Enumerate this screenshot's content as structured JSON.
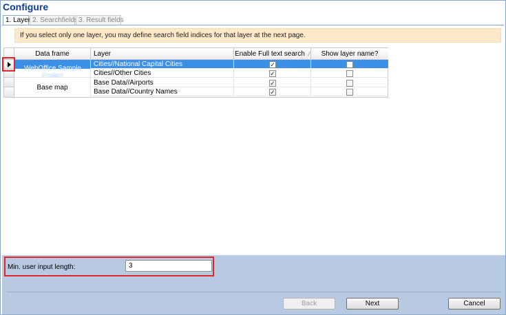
{
  "window": {
    "title": "Configure"
  },
  "tabs": [
    {
      "label": "1. Layer",
      "active": true
    },
    {
      "label": "2. Searchfields",
      "active": false
    },
    {
      "label": "3. Result fields",
      "active": false
    }
  ],
  "notice": "If you select only one layer, you may define search field indices for that layer at the next page.",
  "grid": {
    "columns": [
      "Data frame",
      "Layer",
      "Enable Full text search",
      "Show layer name?"
    ],
    "groups": [
      "WebOffice Sample Project",
      "Base map"
    ],
    "rows": [
      {
        "layer": "Cities//National Capital Cities",
        "fulltext": true,
        "showname": false,
        "selected": true
      },
      {
        "layer": "Cities//Other Cities",
        "fulltext": true,
        "showname": false,
        "selected": false
      },
      {
        "layer": "Base Data//Airports",
        "fulltext": true,
        "showname": false,
        "selected": false
      },
      {
        "layer": "Base Data//Country Names",
        "fulltext": true,
        "showname": false,
        "selected": false
      }
    ]
  },
  "min_input": {
    "label": "Min. user input length:",
    "value": "3"
  },
  "buttons": {
    "back": "Back",
    "next": "Next",
    "cancel": "Cancel"
  },
  "colors": {
    "selection": "#3b8fe5",
    "highlight": "#e0242c",
    "panel": "#b8c9e2",
    "notice": "#fde9c9"
  },
  "icons": {
    "row_pointer": "triangle-right",
    "check": "checkmark"
  }
}
